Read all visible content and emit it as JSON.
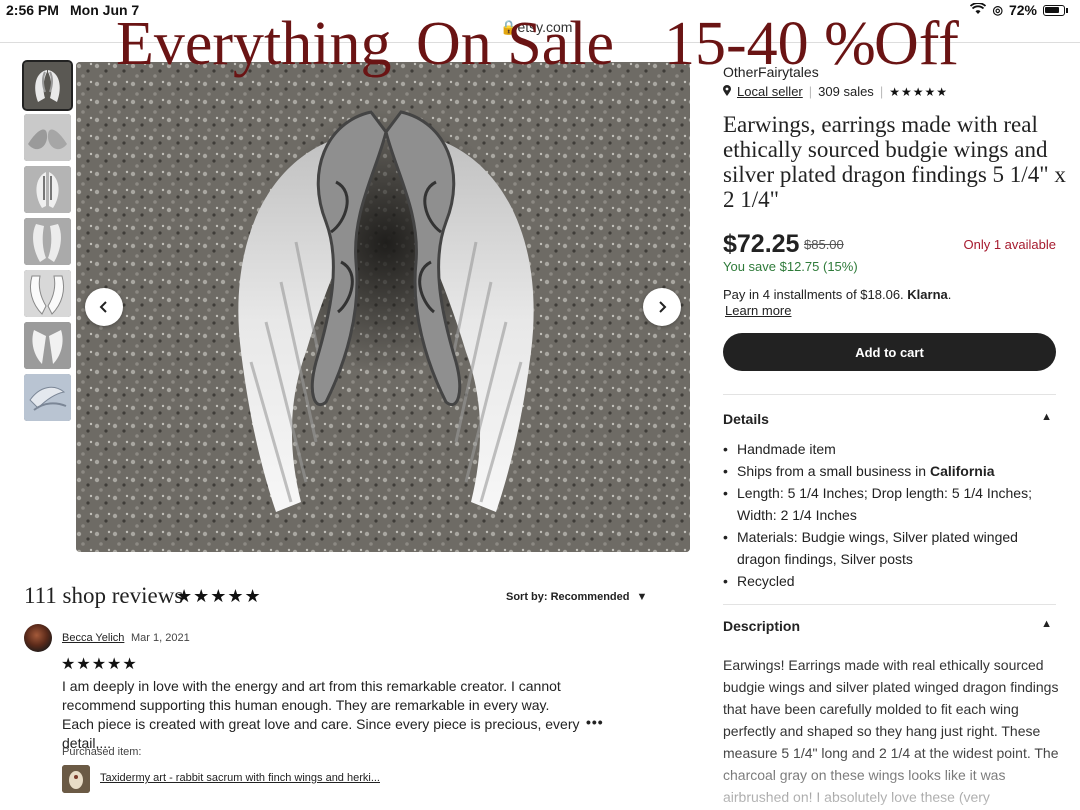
{
  "status_bar": {
    "time": "2:56 PM",
    "date": "Mon Jun 7",
    "battery": "72%"
  },
  "browser": {
    "url": "etsy.com"
  },
  "banner": {
    "word1": "Everything",
    "word2": "On Sale",
    "word3": "15-40 %",
    "word4": "Off"
  },
  "gallery": {
    "thumbnail_count": 7,
    "prev_icon": "chevron-left-icon",
    "next_icon": "chevron-right-icon"
  },
  "shop": {
    "name": "OtherFairytales",
    "local_seller": "Local seller",
    "sales": "309 sales",
    "stars": "★★★★★"
  },
  "listing": {
    "title": "Earwings, earrings made with real ethically sourced budgie wings and silver plated dragon findings 5 1/4\" x 2 1/4\"",
    "price": "$72.25",
    "original_price": "$85.00",
    "stock": "Only 1 available",
    "savings": "You save $12.75 (15%)",
    "installments_text": "Pay in 4 installments of $18.06.",
    "installments_brand": "Klarna",
    "learn_more": "Learn more",
    "add_to_cart": "Add to cart"
  },
  "details": {
    "heading": "Details",
    "items": {
      "handmade": "Handmade item",
      "ships_prefix": "Ships from a small business in",
      "ships_location": "California",
      "length": "Length: 5 1/4 Inches; Drop length: 5 1/4 Inches; Width: 2 1/4 Inches",
      "materials": "Materials: Budgie wings, Silver plated winged dragon findings, Silver posts",
      "recycled": "Recycled"
    }
  },
  "description": {
    "heading": "Description",
    "text": "Earwings! Earrings made with real ethically sourced budgie wings and silver plated winged dragon findings that have been carefully molded to fit each wing perfectly and shaped so they hang just right. These measure 5 1/4\" long and 2 1/4 at the widest point. The charcoal gray on these wings looks like it was airbrushed on! I absolutely love these (very expensive!)"
  },
  "reviews": {
    "title": "111 shop reviews",
    "stars": "★★★★★",
    "sort_label": "Sort by: Recommended",
    "review": {
      "author": "Becca Yelich",
      "date": "Mar 1, 2021",
      "stars": "★★★★★",
      "text": "I am deeply in love with the energy and art from this remarkable creator. I cannot recommend supporting this human enough. They are remarkable in every way. Each piece is created with great love and care. Since every piece is precious, every detail,...",
      "more": "•••",
      "purchased_label": "Purchased item:",
      "purchased_item": "Taxidermy art - rabbit sacrum with finch wings and herki..."
    }
  }
}
